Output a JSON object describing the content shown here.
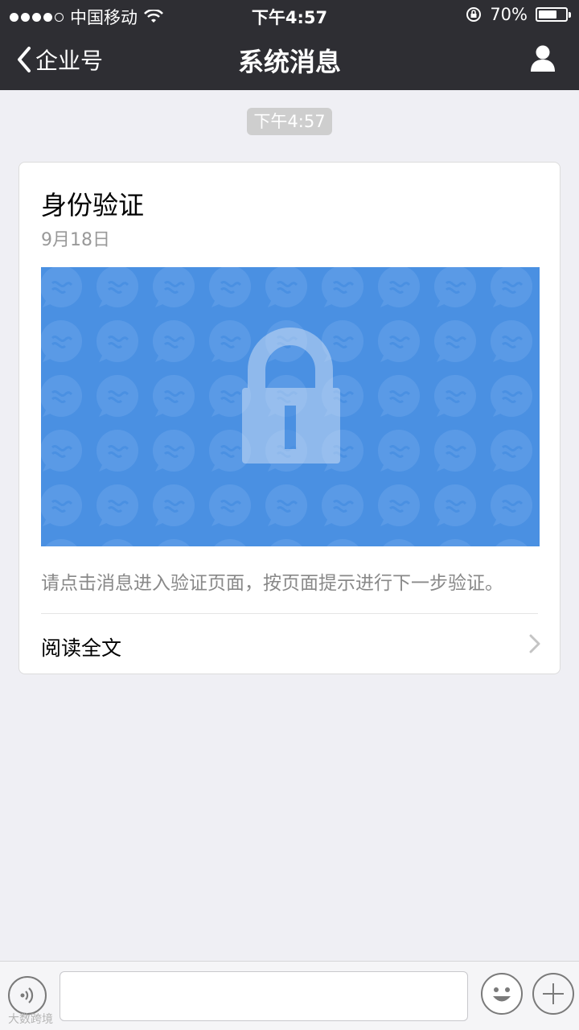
{
  "status_bar": {
    "carrier": "中国移动",
    "time": "下午4:57",
    "battery_text": "70%",
    "battery_level": 0.7
  },
  "nav": {
    "back_label": "企业号",
    "title": "系统消息"
  },
  "timestamp": "下午4:57",
  "card": {
    "title": "身份验证",
    "date": "9月18日",
    "description": "请点击消息进入验证页面，按页面提示进行下一步验证。",
    "read_more": "阅读全文"
  },
  "input_bar": {
    "placeholder": ""
  },
  "watermark": "大数跨境",
  "colors": {
    "topbar": "#2e2e33",
    "banner_blue": "#4a90e2",
    "background": "#efeff4"
  }
}
